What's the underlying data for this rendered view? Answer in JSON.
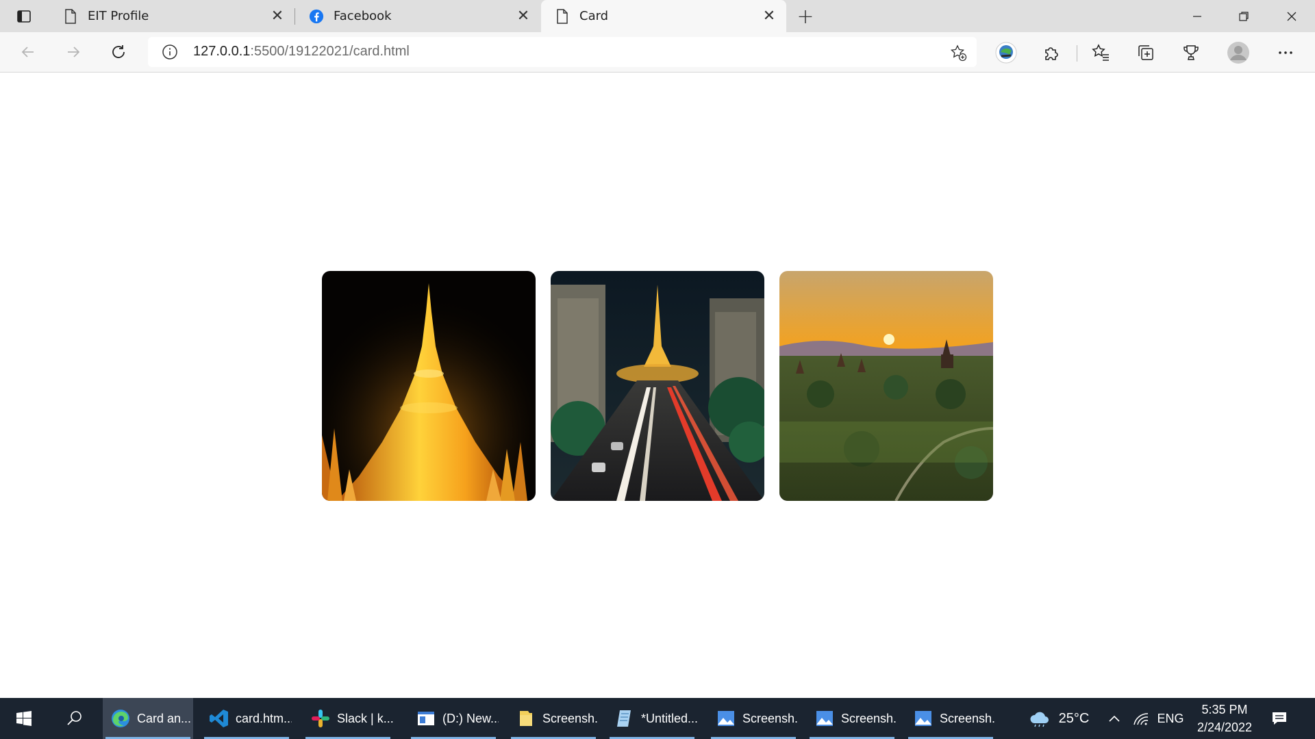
{
  "browser": {
    "tabs": [
      {
        "title": "EIT Profile",
        "active": false,
        "icon": "page-icon"
      },
      {
        "title": "Facebook",
        "active": false,
        "icon": "facebook-icon"
      },
      {
        "title": "Card",
        "active": true,
        "icon": "page-icon"
      }
    ],
    "url_host": "127.0.0.1",
    "url_path": ":5500/19122021/card.html"
  },
  "page": {
    "cards": [
      {
        "name": "golden-pagoda-night",
        "alt": "Golden pagoda at night"
      },
      {
        "name": "city-street-pagoda",
        "alt": "City street leading to pagoda at night"
      },
      {
        "name": "temples-sunset",
        "alt": "Temples at sunset"
      }
    ]
  },
  "taskbar": {
    "apps": [
      {
        "label": "Card an...",
        "icon": "edge-icon",
        "active": true
      },
      {
        "label": "card.htm...",
        "icon": "vscode-icon",
        "active": false
      },
      {
        "label": "Slack | k...",
        "icon": "slack-icon",
        "active": false
      },
      {
        "label": "(D:) New...",
        "icon": "explorer-window-icon",
        "active": false
      },
      {
        "label": "Screensh...",
        "icon": "folder-icon",
        "active": false
      },
      {
        "label": "*Untitled...",
        "icon": "notepad-icon",
        "active": false
      },
      {
        "label": "Screensh...",
        "icon": "photos-icon",
        "active": false
      },
      {
        "label": "Screensh...",
        "icon": "photos-icon",
        "active": false
      },
      {
        "label": "Screensh...",
        "icon": "photos-icon",
        "active": false
      }
    ],
    "weather_temp": "25°C",
    "language": "ENG",
    "time": "5:35 PM",
    "date": "2/24/2022"
  },
  "colors": {
    "tabstrip": "#dfdfdf",
    "toolbar": "#f7f7f7",
    "taskbar": "#1b2430",
    "accent": "#7fb4e6"
  }
}
